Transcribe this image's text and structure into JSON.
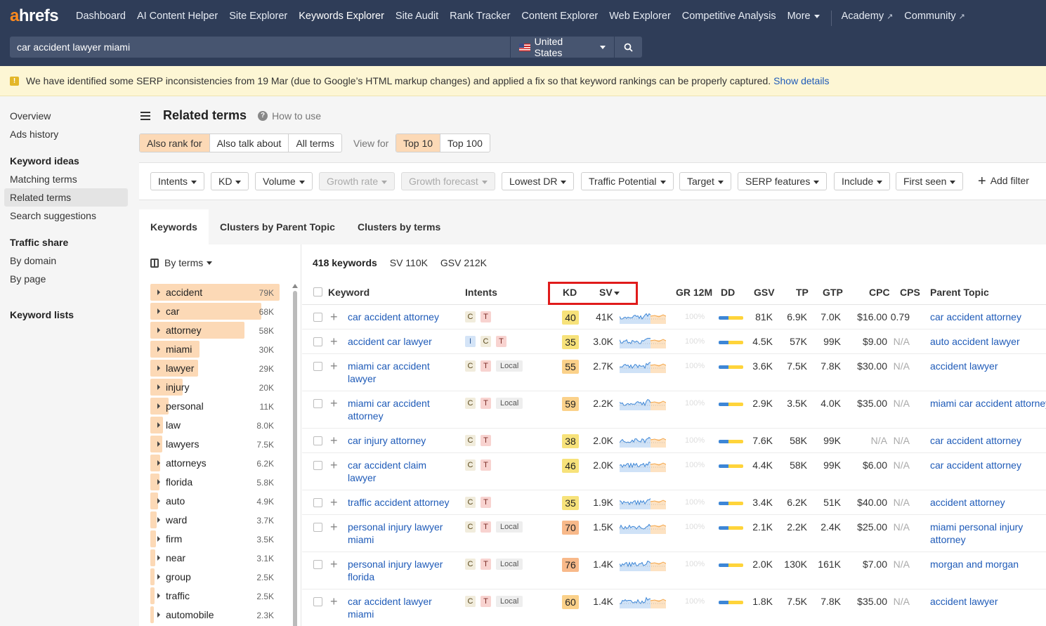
{
  "nav": {
    "logo_a": "a",
    "logo_rest": "hrefs",
    "items": [
      "Dashboard",
      "AI Content Helper",
      "Site Explorer",
      "Keywords Explorer",
      "Site Audit",
      "Rank Tracker",
      "Content Explorer",
      "Web Explorer",
      "Competitive Analysis",
      "More"
    ],
    "academy": "Academy",
    "community": "Community"
  },
  "search": {
    "query": "car accident lawyer miami",
    "country": "United States"
  },
  "banner": {
    "text": "We have identified some SERP inconsistencies from 19 Mar (due to Google’s HTML markup changes) and applied a fix so that keyword rankings can be properly captured.",
    "link": "Show details"
  },
  "sidebar": {
    "overview": "Overview",
    "ads_history": "Ads history",
    "keyword_ideas": "Keyword ideas",
    "matching_terms": "Matching terms",
    "related_terms": "Related terms",
    "search_suggestions": "Search suggestions",
    "traffic_share": "Traffic share",
    "by_domain": "By domain",
    "by_page": "By page",
    "keyword_lists": "Keyword lists"
  },
  "header": {
    "title": "Related terms",
    "help": "How to use"
  },
  "mode_tabs": [
    "Also rank for",
    "Also talk about",
    "All terms"
  ],
  "view_for_label": "View for",
  "view_tabs": [
    "Top 10",
    "Top 100"
  ],
  "filters": [
    "Intents",
    "KD",
    "Volume",
    "Growth rate",
    "Growth forecast",
    "Lowest DR",
    "Traffic Potential",
    "Target",
    "SERP features",
    "Include",
    "First seen"
  ],
  "add_filter": "Add filter",
  "panel_tabs": [
    "Keywords",
    "Clusters by Parent Topic",
    "Clusters by terms"
  ],
  "by_terms": "By terms",
  "terms": [
    {
      "label": "accident",
      "count": "79K",
      "fill": 1.0
    },
    {
      "label": "car",
      "count": "68K",
      "fill": 0.86
    },
    {
      "label": "attorney",
      "count": "58K",
      "fill": 0.73
    },
    {
      "label": "miami",
      "count": "30K",
      "fill": 0.38
    },
    {
      "label": "lawyer",
      "count": "29K",
      "fill": 0.37
    },
    {
      "label": "injury",
      "count": "20K",
      "fill": 0.25
    },
    {
      "label": "personal",
      "count": "11K",
      "fill": 0.14
    },
    {
      "label": "law",
      "count": "8.0K",
      "fill": 0.1
    },
    {
      "label": "lawyers",
      "count": "7.5K",
      "fill": 0.095
    },
    {
      "label": "attorneys",
      "count": "6.2K",
      "fill": 0.078
    },
    {
      "label": "florida",
      "count": "5.8K",
      "fill": 0.073
    },
    {
      "label": "auto",
      "count": "4.9K",
      "fill": 0.062
    },
    {
      "label": "ward",
      "count": "3.7K",
      "fill": 0.047
    },
    {
      "label": "firm",
      "count": "3.5K",
      "fill": 0.044
    },
    {
      "label": "near",
      "count": "3.1K",
      "fill": 0.039
    },
    {
      "label": "group",
      "count": "2.5K",
      "fill": 0.032
    },
    {
      "label": "traffic",
      "count": "2.5K",
      "fill": 0.032
    },
    {
      "label": "automobile",
      "count": "2.3K",
      "fill": 0.029
    }
  ],
  "summary": {
    "keywords": "418 keywords",
    "sv": "SV 110K",
    "gsv": "GSV 212K"
  },
  "columns": [
    "Keyword",
    "Intents",
    "KD",
    "SV",
    "GR 12M",
    "DD",
    "GSV",
    "TP",
    "GTP",
    "CPC",
    "CPS",
    "Parent Topic"
  ],
  "gr_placeholder": "100%",
  "colors": {
    "kd_easy": "#f7e27a",
    "kd_medium": "#fbd18a",
    "kd_hard": "#f8b98a",
    "spark_line": "#3d86d6",
    "spark_fill": "#cfe2f7",
    "spark_serp": "#f4a64a"
  },
  "rows": [
    {
      "keyword": [
        "car accident attorney"
      ],
      "intents": [
        "C",
        "T"
      ],
      "kd": "40",
      "sv": "41K",
      "gsv": "81K",
      "tp": "6.9K",
      "gtp": "7.0K",
      "cpc": "$16.00",
      "cps": "0.79",
      "parent": [
        "car accident attorney"
      ]
    },
    {
      "keyword": [
        "accident car lawyer"
      ],
      "intents": [
        "I",
        "C",
        "T"
      ],
      "kd": "35",
      "sv": "3.0K",
      "gsv": "4.5K",
      "tp": "57K",
      "gtp": "99K",
      "cpc": "$9.00",
      "cps": "N/A",
      "parent": [
        "auto accident lawyer"
      ]
    },
    {
      "keyword": [
        "miami car accident",
        "lawyer"
      ],
      "intents": [
        "C",
        "T",
        "Local"
      ],
      "kd": "55",
      "sv": "2.7K",
      "gsv": "3.6K",
      "tp": "7.5K",
      "gtp": "7.8K",
      "cpc": "$30.00",
      "cps": "N/A",
      "parent": [
        "accident lawyer"
      ]
    },
    {
      "keyword": [
        "miami car accident",
        "attorney"
      ],
      "intents": [
        "C",
        "T",
        "Local"
      ],
      "kd": "59",
      "sv": "2.2K",
      "gsv": "2.9K",
      "tp": "3.5K",
      "gtp": "4.0K",
      "cpc": "$35.00",
      "cps": "N/A",
      "parent": [
        "miami car accident attorney"
      ]
    },
    {
      "keyword": [
        "car injury attorney"
      ],
      "intents": [
        "C",
        "T"
      ],
      "kd": "38",
      "sv": "2.0K",
      "gsv": "7.6K",
      "tp": "58K",
      "gtp": "99K",
      "cpc": "N/A",
      "cps": "N/A",
      "parent": [
        "car accident attorney"
      ]
    },
    {
      "keyword": [
        "car accident claim",
        "lawyer"
      ],
      "intents": [
        "C",
        "T"
      ],
      "kd": "46",
      "sv": "2.0K",
      "gsv": "4.4K",
      "tp": "58K",
      "gtp": "99K",
      "cpc": "$6.00",
      "cps": "N/A",
      "parent": [
        "car accident attorney"
      ]
    },
    {
      "keyword": [
        "traffic accident attorney"
      ],
      "intents": [
        "C",
        "T"
      ],
      "kd": "35",
      "sv": "1.9K",
      "gsv": "3.4K",
      "tp": "6.2K",
      "gtp": "51K",
      "cpc": "$40.00",
      "cps": "N/A",
      "parent": [
        "accident attorney"
      ]
    },
    {
      "keyword": [
        "personal injury lawyer",
        "miami"
      ],
      "intents": [
        "C",
        "T",
        "Local"
      ],
      "kd": "70",
      "sv": "1.5K",
      "gsv": "2.1K",
      "tp": "2.2K",
      "gtp": "2.4K",
      "cpc": "$25.00",
      "cps": "N/A",
      "parent": [
        "miami personal injury",
        "attorney"
      ]
    },
    {
      "keyword": [
        "personal injury lawyer",
        "florida"
      ],
      "intents": [
        "C",
        "T",
        "Local"
      ],
      "kd": "76",
      "sv": "1.4K",
      "gsv": "2.0K",
      "tp": "130K",
      "gtp": "161K",
      "cpc": "$7.00",
      "cps": "N/A",
      "parent": [
        "morgan and morgan"
      ]
    },
    {
      "keyword": [
        "car accident lawyer",
        "miami"
      ],
      "intents": [
        "C",
        "T",
        "Local"
      ],
      "kd": "60",
      "sv": "1.4K",
      "gsv": "1.8K",
      "tp": "7.5K",
      "gtp": "7.8K",
      "cpc": "$35.00",
      "cps": "N/A",
      "parent": [
        "accident lawyer"
      ]
    }
  ]
}
